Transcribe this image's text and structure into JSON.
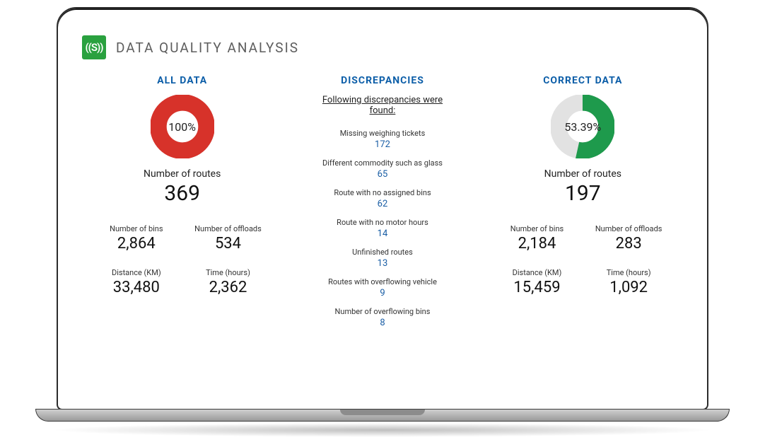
{
  "header": {
    "logo_text": "((S))",
    "title": "DATA QUALITY ANALYSIS"
  },
  "all_data": {
    "heading": "ALL DATA",
    "pct_label": "100%",
    "pct_value": 100,
    "routes_label": "Number of routes",
    "routes_value": "369",
    "metrics": {
      "bins_label": "Number of bins",
      "bins_value": "2,864",
      "offloads_label": "Number of offloads",
      "offloads_value": "534",
      "distance_label": "Distance (KM)",
      "distance_value": "33,480",
      "time_label": "Time (hours)",
      "time_value": "2,362"
    }
  },
  "discrepancies": {
    "heading": "DISCREPANCIES",
    "subheading": "Following discrepancies were found:",
    "items": [
      {
        "label": "Missing weighing tickets",
        "value": "172"
      },
      {
        "label": "Different commodity such as glass",
        "value": "65"
      },
      {
        "label": "Route with no assigned bins",
        "value": "62"
      },
      {
        "label": "Route with no motor hours",
        "value": "14"
      },
      {
        "label": "Unfinished routes",
        "value": "13"
      },
      {
        "label": "Routes with overflowing vehicle",
        "value": "9"
      },
      {
        "label": "Number of overflowing bins",
        "value": "8"
      }
    ]
  },
  "correct_data": {
    "heading": "CORRECT DATA",
    "pct_label": "53.39%",
    "pct_value": 53.39,
    "routes_label": "Number of routes",
    "routes_value": "197",
    "metrics": {
      "bins_label": "Number of bins",
      "bins_value": "2,184",
      "offloads_label": "Number of offloads",
      "offloads_value": "283",
      "distance_label": "Distance (KM)",
      "distance_value": "15,459",
      "time_label": "Time (hours)",
      "time_value": "1,092"
    }
  },
  "chart_data": [
    {
      "type": "pie",
      "title": "ALL DATA",
      "series": [
        {
          "name": "All data",
          "values": [
            100
          ]
        }
      ],
      "ylim": [
        0,
        100
      ]
    },
    {
      "type": "pie",
      "title": "CORRECT DATA",
      "series": [
        {
          "name": "Correct data",
          "values": [
            53.39
          ]
        }
      ],
      "ylim": [
        0,
        100
      ]
    }
  ]
}
